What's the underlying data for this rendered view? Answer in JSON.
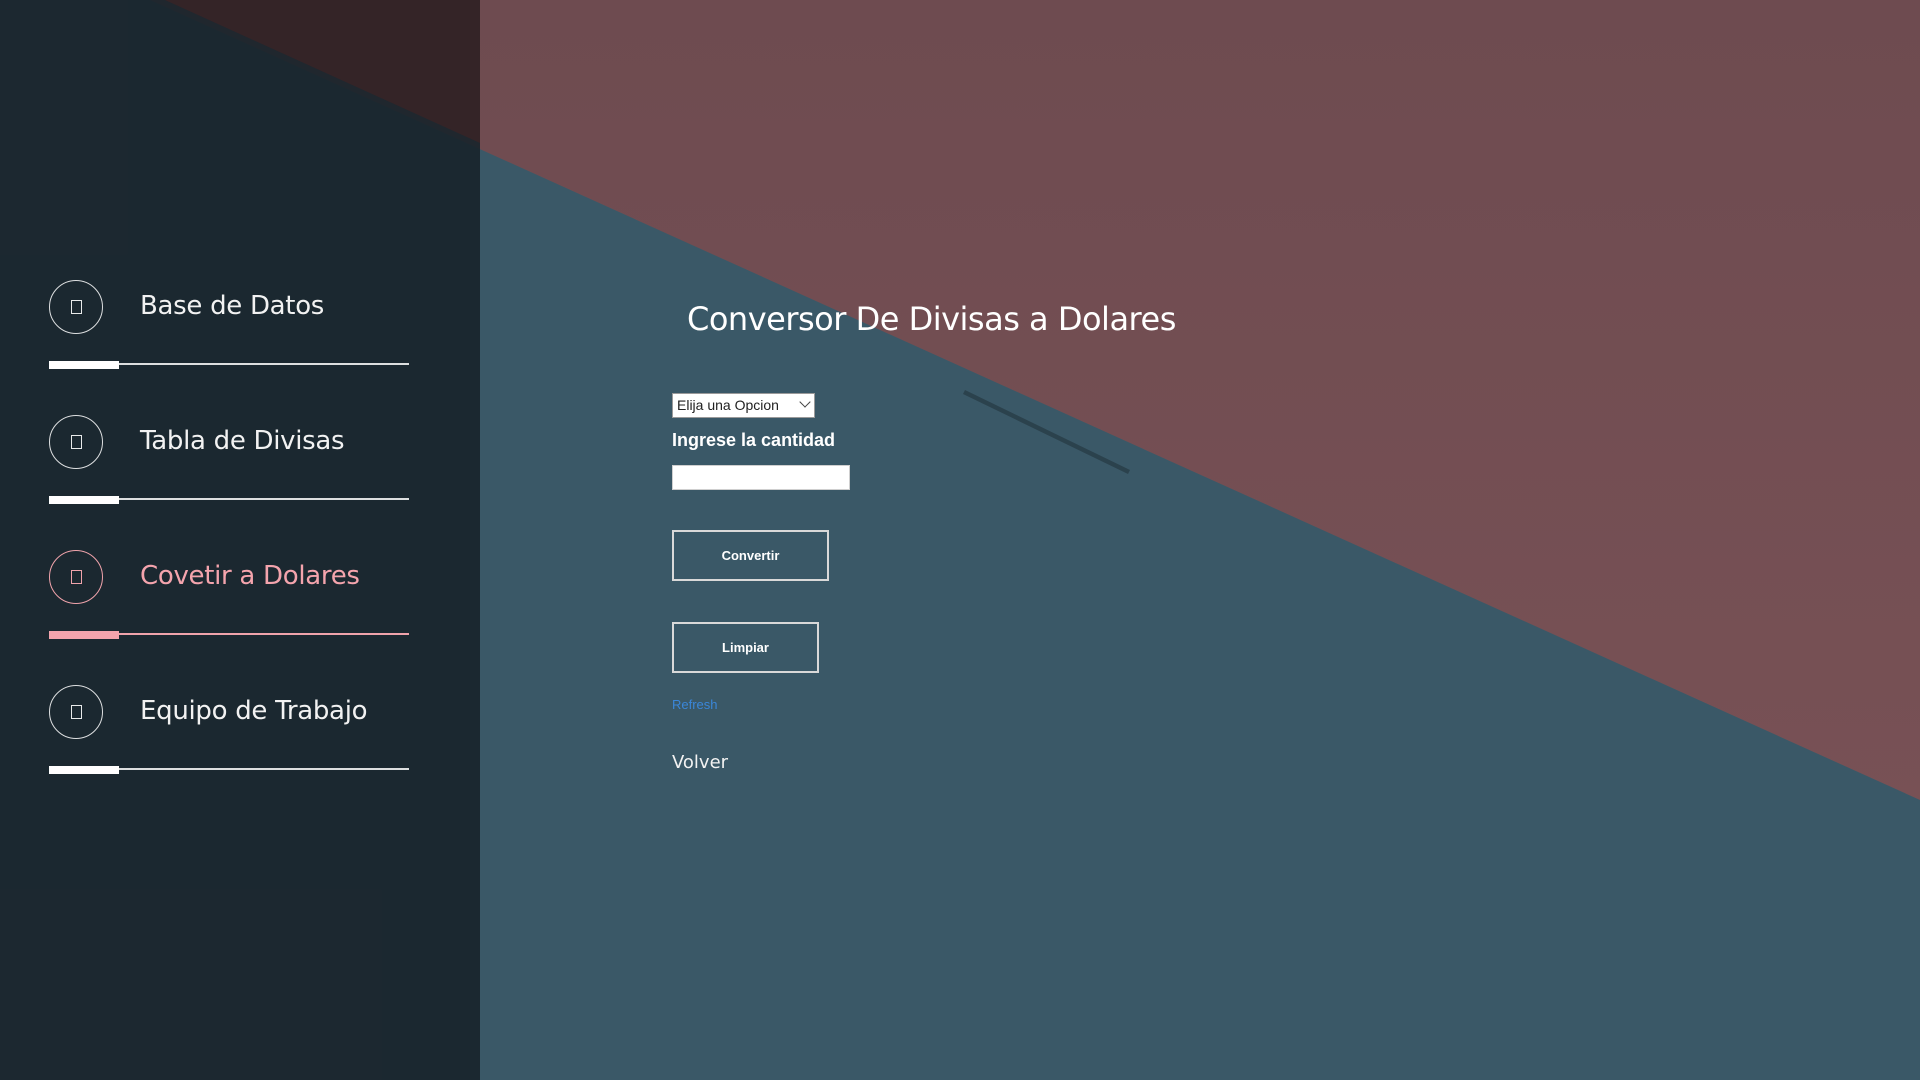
{
  "sidebar": {
    "items": [
      {
        "label": "Base de Datos",
        "icon": "square-icon",
        "active": false
      },
      {
        "label": "Tabla de Divisas",
        "icon": "square-icon",
        "active": false
      },
      {
        "label": "Covetir a Dolares",
        "icon": "square-icon",
        "active": true
      },
      {
        "label": "Equipo de Trabajo",
        "icon": "square-icon",
        "active": false
      }
    ]
  },
  "main": {
    "title": "Conversor De Divisas a Dolares",
    "select": {
      "selected": "Elija una Opcion"
    },
    "amount_label": "Ingrese la cantidad",
    "amount_value": "",
    "convert_label": "Convertir",
    "clear_label": "Limpiar",
    "refresh_label": "Refresh",
    "back_label": "Volver"
  },
  "colors": {
    "sidebar_bg": "#19242b",
    "accent_pink": "#f4a4ad",
    "bg_blue": "#3a5867",
    "bg_red": "#7b5357",
    "link_blue": "#3a86d8"
  }
}
